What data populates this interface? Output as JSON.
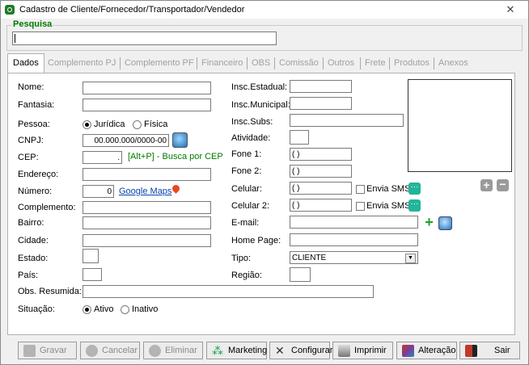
{
  "window": {
    "title": "Cadastro de Cliente/Fornecedor/Transportador/Vendedor",
    "close_glyph": "✕"
  },
  "search": {
    "label": "Pesquisa",
    "value": ""
  },
  "tabs": [
    "Dados",
    "Complemento PJ",
    "Complemento PF",
    "Financeiro",
    "OBS",
    "Comissão",
    "Outros",
    "Frete",
    "Produtos",
    "Anexos"
  ],
  "left": {
    "nome": "Nome:",
    "fantasia": "Fantasia:",
    "pessoa": "Pessoa:",
    "pessoa_juridica": "Jurídica",
    "pessoa_fisica": "Física",
    "cnpj": "CNPJ:",
    "cnpj_value": "00.000.000/0000-00",
    "cep": "CEP:",
    "cep_value": ".",
    "cep_hint": "[Alt+P]  - Busca por CEP",
    "endereco": "Endereço:",
    "numero": "Número:",
    "numero_value": "0",
    "google_maps": "Google Maps",
    "complemento": "Complemento:",
    "bairro": "Bairro:",
    "cidade": "Cidade:",
    "estado": "Estado:",
    "pais": "País:",
    "obs": "Obs. Resumida:",
    "situacao": "Situação:",
    "situacao_ativo": "Ativo",
    "situacao_inativo": "Inativo"
  },
  "right": {
    "insc_estadual": "Insc.Estadual:",
    "insc_municipal": "Insc.Municipal:",
    "insc_subs": "Insc.Subs:",
    "atividade": "Atividade:",
    "fone1": "Fone 1:",
    "fone1_value": "(  )",
    "fone2": "Fone 2:",
    "fone2_value": "(  )",
    "celular": "Celular:",
    "celular_value": "(  )",
    "celular2": "Celular 2:",
    "celular2_value": "(  )",
    "envia_sms": "Envia SMS",
    "email": "E-mail:",
    "homepage": "Home Page:",
    "tipo": "Tipo:",
    "tipo_value": "CLIENTE",
    "regiao": "Região:"
  },
  "buttons": {
    "gravar": "Gravar",
    "cancelar": "Cancelar",
    "eliminar": "Eliminar",
    "marketing": "Marketing",
    "configurar": "Configurar",
    "imprimir": "Imprimir",
    "alteracao": "Alteração",
    "sair": "Sair"
  },
  "colors": {
    "accent_green": "#007a00",
    "link_blue": "#0645ad",
    "sms_teal": "#22b59a"
  }
}
